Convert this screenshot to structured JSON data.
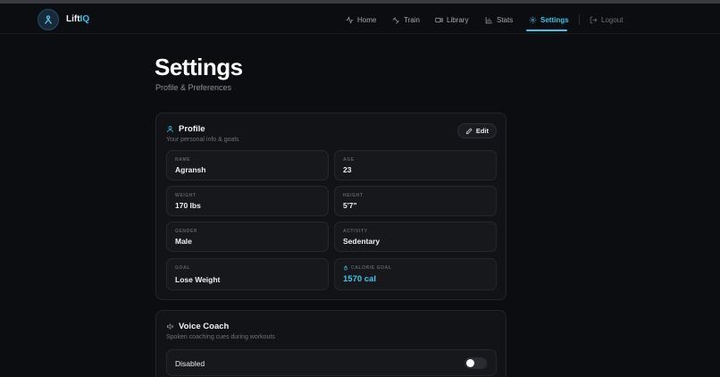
{
  "app": {
    "name_prefix": "Lift",
    "name_accent": "IQ",
    "badge_text": "LiftIQ"
  },
  "nav": {
    "items": [
      {
        "label": "Home",
        "icon": "activity-icon"
      },
      {
        "label": "Train",
        "icon": "dumbbell-icon"
      },
      {
        "label": "Library",
        "icon": "video-icon"
      },
      {
        "label": "Stats",
        "icon": "bar-chart-icon"
      },
      {
        "label": "Settings",
        "icon": "gear-icon",
        "active": true
      }
    ],
    "logout_label": "Logout"
  },
  "page": {
    "title": "Settings",
    "subtitle": "Profile & Preferences"
  },
  "profile": {
    "title": "Profile",
    "description": "Your personal info & goals",
    "edit_label": "Edit",
    "fields": [
      {
        "label": "NAME",
        "value": "Agransh"
      },
      {
        "label": "AGE",
        "value": "23"
      },
      {
        "label": "WEIGHT",
        "value": "170 lbs"
      },
      {
        "label": "HEIGHT",
        "value": "5'7\""
      },
      {
        "label": "GENDER",
        "value": "Male"
      },
      {
        "label": "ACTIVITY",
        "value": "Sedentary"
      },
      {
        "label": "GOAL",
        "value": "Lose Weight"
      },
      {
        "label": "CALORIE GOAL",
        "value": "1570 cal"
      }
    ]
  },
  "voice": {
    "title": "Voice Coach",
    "description": "Spoken coaching cues during workouts",
    "toggle_label": "Disabled",
    "enabled": false
  },
  "colors": {
    "accent": "#3cc4ea",
    "background": "#0c0d10",
    "card": "#121317"
  }
}
